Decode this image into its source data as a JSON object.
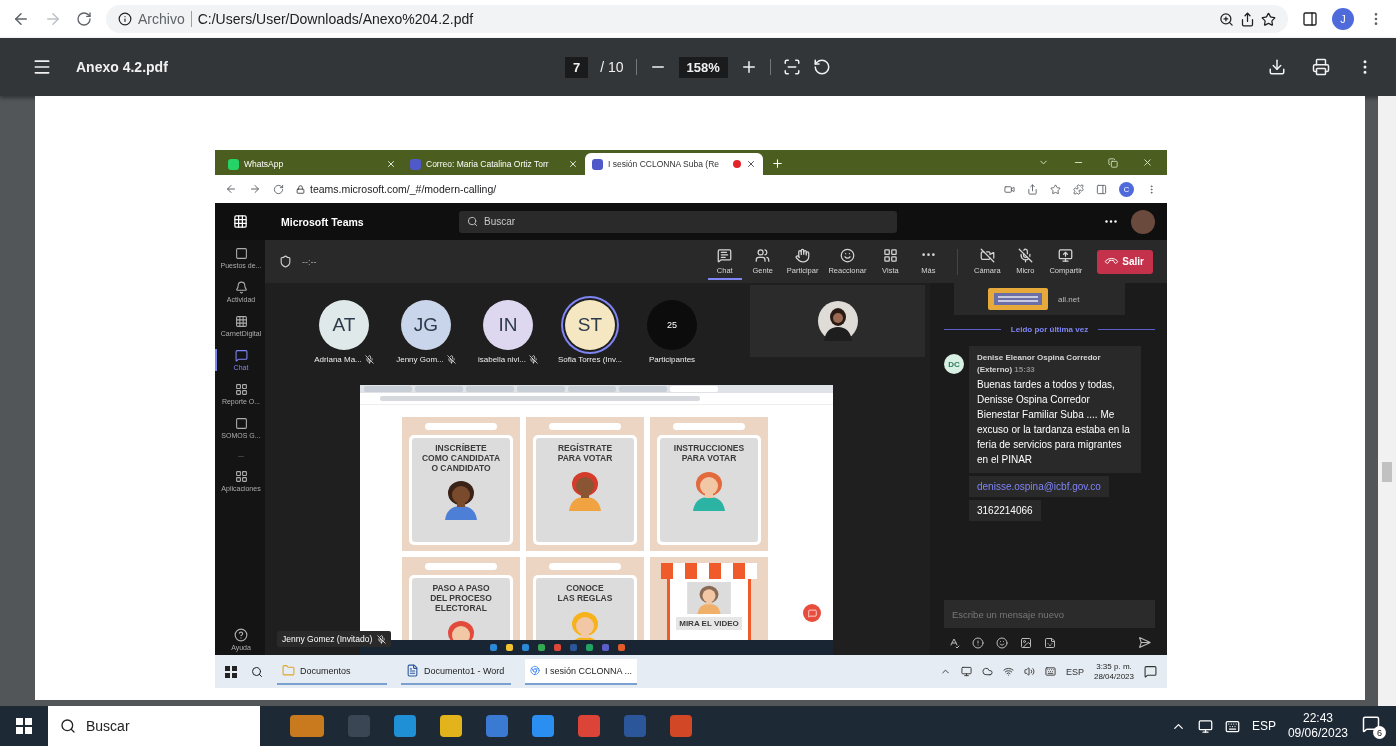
{
  "browser": {
    "info_label": "Archivo",
    "url": "C:/Users/User/Downloads/Anexo%204.2.pdf",
    "profile_initial": "J"
  },
  "pdf_toolbar": {
    "title": "Anexo 4.2.pdf",
    "page": "7",
    "page_total": "/ 10",
    "zoom": "158%"
  },
  "document_screenshot": {
    "browser_tabs": [
      {
        "title": "WhatsApp",
        "selected": false,
        "recording": false
      },
      {
        "title": "Correo: Maria Catalina Ortiz Torr",
        "selected": false,
        "recording": false
      },
      {
        "title": "I sesión CCLONNA Suba (Re",
        "selected": true,
        "recording": true
      }
    ],
    "url": "teams.microsoft.com/_#/modern-calling/",
    "profile_initial": "C",
    "teams": {
      "app_name": "Microsoft Teams",
      "search_placeholder": "Buscar",
      "rail": [
        {
          "label": "Puestos de...",
          "kind": "square",
          "selected": false
        },
        {
          "label": "Actividad",
          "kind": "bell",
          "selected": false
        },
        {
          "label": "CarnetDigital",
          "kind": "dots",
          "selected": false
        },
        {
          "label": "Chat",
          "kind": "chat",
          "selected": true
        },
        {
          "label": "Reporte O...",
          "kind": "grid",
          "selected": false
        },
        {
          "label": "SOMOS G...",
          "kind": "square",
          "selected": false
        },
        {
          "label": "...",
          "kind": "text",
          "selected": false
        },
        {
          "label": "Aplicaciones",
          "kind": "apps",
          "selected": false
        }
      ],
      "help_label": "Ayuda",
      "timer": "--:--",
      "actions": [
        {
          "label": "Chat",
          "kind": "chat",
          "selected": true
        },
        {
          "label": "Gente",
          "kind": "people",
          "selected": false
        },
        {
          "label": "Participar",
          "kind": "hand",
          "selected": false
        },
        {
          "label": "Reaccionar",
          "kind": "smile",
          "selected": false
        },
        {
          "label": "Vista",
          "kind": "grid",
          "selected": false
        },
        {
          "label": "Más",
          "kind": "more",
          "selected": false
        }
      ],
      "devices": [
        {
          "label": "Cámara",
          "kind": "camera"
        },
        {
          "label": "Micro",
          "kind": "mic"
        },
        {
          "label": "Compartir",
          "kind": "share"
        }
      ],
      "leave_label": "Salir",
      "participants": [
        {
          "initials": "AT",
          "name": "Adriana Ma...",
          "muted": true,
          "speaking": false,
          "color": "#dfe9ea"
        },
        {
          "initials": "JG",
          "name": "Jenny Gom...",
          "muted": true,
          "speaking": false,
          "color": "#c9d5ea"
        },
        {
          "initials": "IN",
          "name": "isabella nivi...",
          "muted": true,
          "speaking": false,
          "color": "#ddd8ef"
        },
        {
          "initials": "ST",
          "name": "Sofia Torres (Inv...",
          "muted": false,
          "speaking": true,
          "color": "#f4e7c2"
        }
      ],
      "participant_count": "25",
      "participants_label": "Participantes",
      "presenter": "Jenny Gomez (Invitado)",
      "shared_screen": {
        "cards": [
          {
            "title": "INSCRÍBETE\nCOMO CANDIDATA\nO CANDIDATO",
            "kind": "poster"
          },
          {
            "title": "REGÍSTRATE\nPARA VOTAR",
            "kind": "poster"
          },
          {
            "title": "INSTRUCCIONES\nPARA VOTAR",
            "kind": "poster"
          },
          {
            "title": "PASO A PASO\nDEL PROCESO\nELECTORAL",
            "kind": "poster"
          },
          {
            "title": "CONOCE\nLAS REGLAS",
            "kind": "poster"
          },
          {
            "title": "MIRA EL VIDEO",
            "kind": "stand"
          }
        ]
      },
      "chat": {
        "preview_site": "all.net",
        "read_marker": "Leido por última vez",
        "message": {
          "initials": "DC",
          "author": "Denise Eleanor Ospina Corredor (Externo)",
          "time": "15:33",
          "text": "Buenas tardes a todos y todas, Denisse Ospina Corredor Bienestar Familiar Suba .... Me excuso or la tardanza estaba en la feria de servicios para migrantes en el PINAR",
          "link": "denisse.ospina@icbf.gov.co",
          "phone": "3162214066"
        },
        "compose_placeholder": "Escribe un mensaje nuevo"
      }
    },
    "taskbar": {
      "items": [
        {
          "label": "Documentos",
          "kind": "folder"
        },
        {
          "label": "Documento1 - Word",
          "kind": "word"
        },
        {
          "label": "I sesión CCLONNA ...",
          "kind": "browser"
        }
      ],
      "language": "ESP",
      "time": "3:35 p. m.",
      "date": "28/04/2023"
    }
  },
  "taskbar": {
    "search_placeholder": "Buscar",
    "language": "ESP",
    "time": "22:43",
    "date": "09/06/2023",
    "notification_count": "6"
  }
}
